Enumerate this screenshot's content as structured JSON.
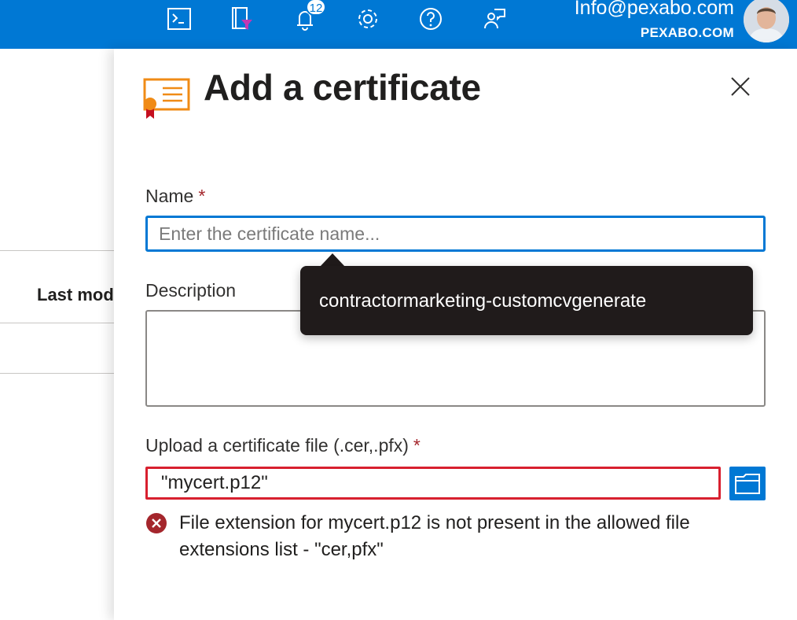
{
  "topbar": {
    "icons": [
      "cloud-shell-icon",
      "directory-filter-icon",
      "notifications-icon",
      "settings-icon",
      "help-icon",
      "feedback-icon"
    ],
    "notification_count": "12",
    "user_email": "Info@pexabo.com",
    "user_org": "PEXABO.COM",
    "bar_color": "#0078d4"
  },
  "background": {
    "column_header": "Last modified"
  },
  "panel": {
    "title": "Add a certificate",
    "name_label": "Name",
    "name_placeholder": "Enter the certificate name...",
    "name_value": "",
    "required_marker": "*",
    "description_label": "Description",
    "description_value": "",
    "upload_label": "Upload a certificate file (.cer,.pfx)",
    "file_value": "\"mycert.p12\"",
    "error_message": "File extension for mycert.p12 is not present in the allowed file extensions list - \"cer,pfx\"",
    "error_color": "#d8202f"
  },
  "tooltip": {
    "text": "contractormarketing-customcvgenerate"
  }
}
